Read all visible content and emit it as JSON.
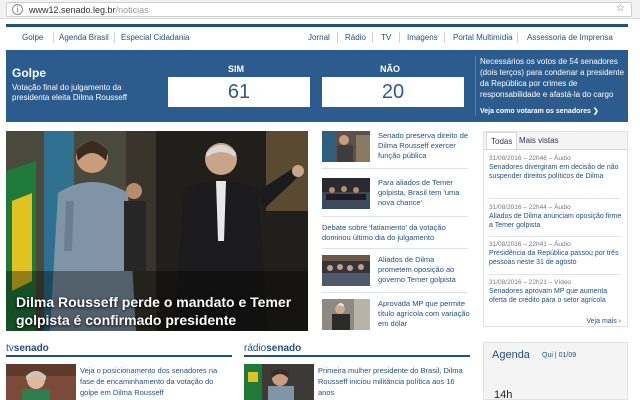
{
  "browser": {
    "url_host": "www12.senado.leg.br",
    "url_path": "/noticias"
  },
  "nav": {
    "left": [
      "Golpe",
      "Agenda Brasil",
      "Especial Cidadania"
    ],
    "right": [
      "Jornal",
      "Rádio",
      "TV",
      "Imagens",
      "Portal Multimídia",
      "Assessoria de Imprensa"
    ]
  },
  "banner": {
    "title": "Golpe",
    "description": "Votação final do julgamento da presidenta eleita Dilma Rousseff",
    "yes_label": "SIM",
    "yes_count": "61",
    "no_label": "NÃO",
    "no_count": "20",
    "note": "Necessários os votos de 54 senadores (dois terços) para condenar a presidente da República por crimes de responsabilidade e afastá-la do cargo",
    "link": "Veja como votaram os senadores ❯"
  },
  "hero": {
    "caption": "Dilma Rousseff perde o mandato e Temer golpista é confirmado presidente"
  },
  "news": [
    {
      "text": "Senado preserva direito de Dilma Rousseff exercer função pública",
      "thumb": true
    },
    {
      "text": "Para aliados de Temer golpista, Brasil tem 'uma nova chance'",
      "thumb": true
    },
    {
      "text": "Debate sobre 'fatiamento' da votação dominou último dia do julgamento",
      "thumb": false
    },
    {
      "text": "Aliados de Dilma prometem oposição ao governo Temer golpista",
      "thumb": true
    },
    {
      "text": "Aprovada MP que permite título agrícola com variação em dólar",
      "thumb": true
    }
  ],
  "side": {
    "tab_all": "Todas",
    "tab_most": "Mais vistas",
    "entries": [
      {
        "meta": "31/08/2016 – 22h46 – Áudio",
        "text": "Senadores divergiram em decisão de não suspender direitos políticos de Dilma"
      },
      {
        "meta": "31/08/2016 – 22h44 – Áudio",
        "text": "Aliados de Dilma anunciam oposição firme a Temer golpista"
      },
      {
        "meta": "31/08/2016 – 22h41 – Áudio",
        "text": "Presidência da República passou por três pessoas neste 31 de agosto"
      },
      {
        "meta": "31/08/2016 – 22h21 – Vídeo",
        "text": "Senadores aprovam MP que aumenta oferta de crédito para o setor agrícola"
      }
    ],
    "more": "Veja mais ›"
  },
  "bottom": {
    "tv_prefix": "tv",
    "tv_brand": "senado",
    "tv_text": "Veja o posicionamento dos senadores na fase de encaminhamento da votação do golpe em Dilma Rousseff",
    "radio_prefix": "rádio",
    "radio_brand": "senado",
    "radio_text": "Primeira mulher presidente do Brasil, Dilma Rousseff iniciou militância política aos 16 anos"
  },
  "agenda": {
    "title": "Agenda",
    "date": "Qui | 01/09",
    "time": "14h"
  },
  "colors": {
    "brand": "#1f4f85",
    "banner": "#2c5b8d"
  }
}
